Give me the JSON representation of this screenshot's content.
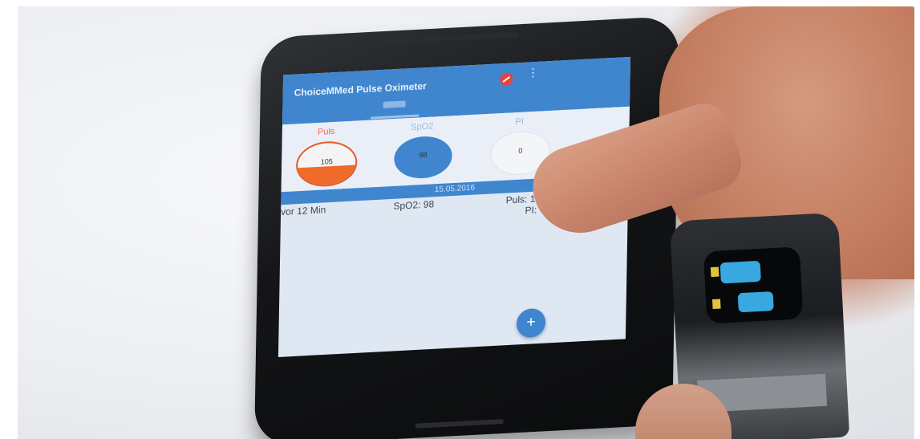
{
  "app": {
    "title": "ChoiceMMed Pulse Oximeter"
  },
  "gauges": [
    {
      "label": "Puls",
      "value": "105"
    },
    {
      "label": "SpO2",
      "value": "98"
    },
    {
      "label": "PI",
      "value": "0"
    }
  ],
  "date_bar": {
    "date": "15.05.2016"
  },
  "reading": {
    "time": "vor 12 Min",
    "spo2": "SpO2: 98",
    "pulse": "Puls: 105",
    "pi": "PI: --"
  },
  "fab": {
    "label": "+"
  },
  "navbar": {
    "back": "◁",
    "home": "○",
    "recent": "□"
  },
  "colors": {
    "primary": "#3f86cf",
    "pulse_accent": "#f06a2c",
    "oximeter_display": "#39a8e0"
  },
  "icons": [
    "stop-icon",
    "overflow-menu-icon",
    "add-icon",
    "back-icon",
    "home-icon",
    "recent-apps-icon"
  ]
}
